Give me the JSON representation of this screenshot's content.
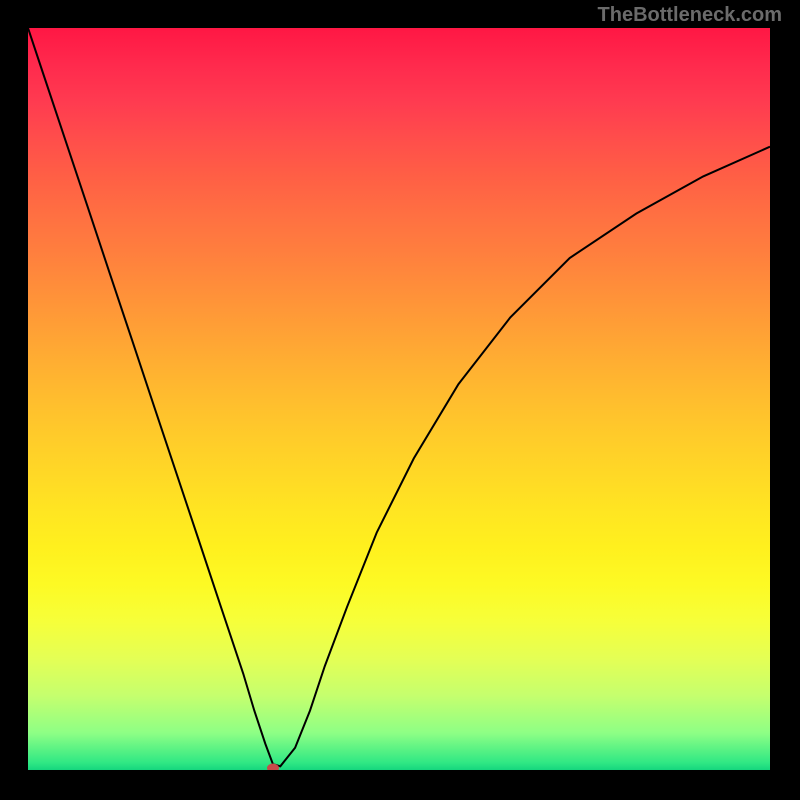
{
  "watermark": "TheBottleneck.com",
  "chart_data": {
    "type": "line",
    "title": "",
    "xlabel": "",
    "ylabel": "",
    "xlim": [
      0,
      100
    ],
    "ylim": [
      0,
      100
    ],
    "x": [
      0,
      2,
      5,
      8,
      11,
      14,
      17,
      20,
      23,
      26,
      29,
      30.5,
      32,
      33,
      34,
      36,
      38,
      40,
      43,
      47,
      52,
      58,
      65,
      73,
      82,
      91,
      100
    ],
    "y": [
      100,
      94,
      85,
      76,
      67,
      58,
      49,
      40,
      31,
      22,
      13,
      8,
      3.5,
      0.8,
      0.5,
      3,
      8,
      14,
      22,
      32,
      42,
      52,
      61,
      69,
      75,
      80,
      84
    ],
    "marker": {
      "x": 33,
      "y": 0.3
    },
    "colors": {
      "gradient_top": "#ff1744",
      "gradient_mid": "#ffd826",
      "gradient_bottom": "#15d67e",
      "curve": "#000000",
      "marker": "#c74a4a",
      "background": "#000000"
    }
  }
}
